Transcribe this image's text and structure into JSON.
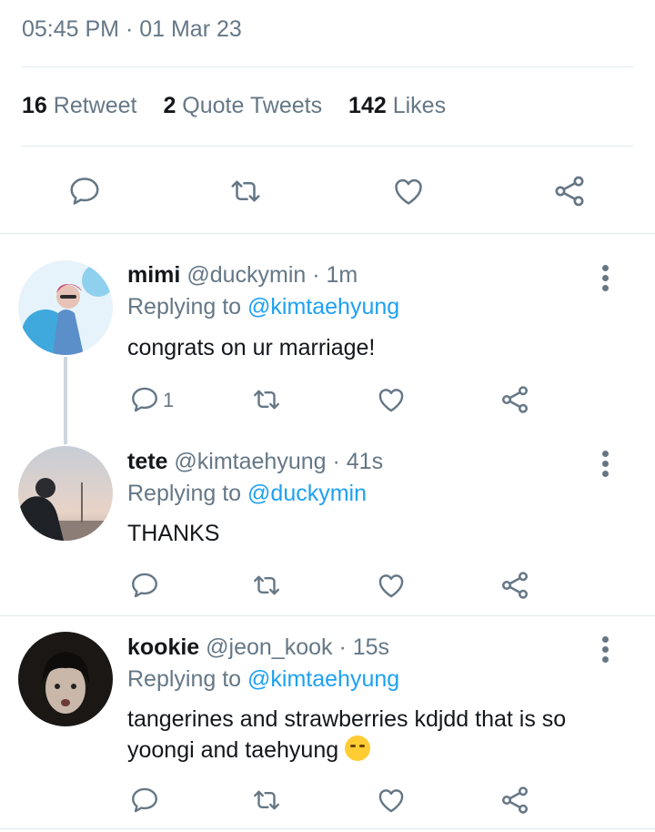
{
  "detail": {
    "timestamp": "05:45 PM · 01 Mar 23",
    "stats": {
      "retweets": "16",
      "retweets_label": "Retweet",
      "quotes": "2",
      "quotes_label": "Quote Tweets",
      "likes": "142",
      "likes_label": "Likes"
    }
  },
  "replies": [
    {
      "name": "mimi",
      "meta": "@duckymin · 1m",
      "replying_prefix": "Replying to",
      "replying_handle": "@kimtaehyung",
      "text": "congrats on ur marriage!",
      "reply_count": "1"
    },
    {
      "name": "tete",
      "meta": "@kimtaehyung · 41s",
      "replying_prefix": "Replying to",
      "replying_handle": "@duckymin",
      "text": "THANKS",
      "reply_count": ""
    },
    {
      "name": "kookie",
      "meta": "@jeon_kook · 15s",
      "replying_prefix": "Replying to",
      "replying_handle": "@kimtaehyung",
      "text": "tangerines and strawberries kdjdd that is so yoongi and taehyung",
      "emoji": "crying-face",
      "reply_count": ""
    }
  ],
  "colors": {
    "link": "#1da1f2",
    "muted": "#657786",
    "divider": "#e1e8ed"
  }
}
